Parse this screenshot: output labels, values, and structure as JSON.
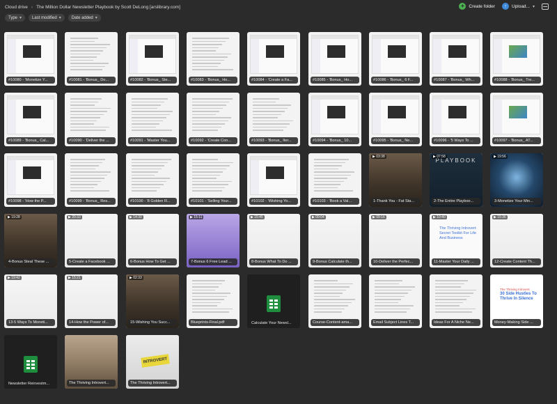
{
  "breadcrumb": {
    "root": "Cloud drive",
    "current": "The Million Dollar Newsletter Playbook by Scott DeLong [arslibrary.com]"
  },
  "toolbar": {
    "create_folder": "Create folder",
    "upload": "Upload..."
  },
  "filters": {
    "type": "Type",
    "last_modified": "Last modified",
    "date_added": "Date added"
  },
  "colors": {
    "background": "#2b2b2b",
    "create_folder_icon": "#4caf50",
    "upload_icon": "#3f8ad8",
    "sheet_icon": "#1e8e3e"
  },
  "files": [
    {
      "name": "#10080 - 'Monetize Y...",
      "kind": "screenshot"
    },
    {
      "name": "#10081 - 'Bonus_ Do...",
      "kind": "doc"
    },
    {
      "name": "#10082 - 'Bonus_ Ste...",
      "kind": "screenshot"
    },
    {
      "name": "#10083 - 'Bonus_ Ho...",
      "kind": "doc"
    },
    {
      "name": "#10084 - 'Create a Fa...",
      "kind": "screenshot"
    },
    {
      "name": "#10085 - 'Bonus_ Ho...",
      "kind": "screenshot"
    },
    {
      "name": "#10086 - 'Bonus_ 6 F...",
      "kind": "screenshot"
    },
    {
      "name": "#10087 - 'Bonus_ Wh...",
      "kind": "screenshot"
    },
    {
      "name": "#10088 - 'Bonus_ Tre...",
      "kind": "screenshot-color"
    },
    {
      "name": "#10089 - 'Bonus_ Cal...",
      "kind": "screenshot"
    },
    {
      "name": "#10090 - 'Deliver the ...",
      "kind": "doc"
    },
    {
      "name": "#10091 - 'Master You...",
      "kind": "doc"
    },
    {
      "name": "#10092 - 'Create Con...",
      "kind": "doc"
    },
    {
      "name": "#10093 - 'Bonus_ Iter...",
      "kind": "doc"
    },
    {
      "name": "#10094 - 'Bonus_ 10...",
      "kind": "screenshot"
    },
    {
      "name": "#10095 - 'Bonus_ Ne...",
      "kind": "screenshot"
    },
    {
      "name": "#10096 - '5 Ways To ...",
      "kind": "screenshot"
    },
    {
      "name": "#10097 - 'Bonus_ AT...",
      "kind": "screenshot-color"
    },
    {
      "name": "#10098 - 'How the P...",
      "kind": "screenshot"
    },
    {
      "name": "#10099 - 'Bonus_ Res...",
      "kind": "doc"
    },
    {
      "name": "#10100 - '8 Golden R...",
      "kind": "doc"
    },
    {
      "name": "#10101 - 'Selling Your...",
      "kind": "doc"
    },
    {
      "name": "#10102 - 'Wishing Yo...",
      "kind": "screenshot"
    },
    {
      "name": "#10103 - 'Book a Val...",
      "kind": "doc"
    },
    {
      "name": "1-Thank You - Fat Sta...",
      "kind": "video",
      "duration": "03:38"
    },
    {
      "name": "2-The Entire Playboo...",
      "kind": "video-playbook",
      "duration": "07:58"
    },
    {
      "name": "3-Monetize Your Min...",
      "kind": "video-blue",
      "duration": "19:56"
    },
    {
      "name": "4-Bonus Steal These ...",
      "kind": "video",
      "duration": "19:28"
    },
    {
      "name": "5-Create a Facebook ...",
      "kind": "video-light",
      "duration": "20:33"
    },
    {
      "name": "6-Bonus How To Get ...",
      "kind": "video-light",
      "duration": "14:30"
    },
    {
      "name": "7-Bonus 6 Free Lead ...",
      "kind": "video-purple",
      "duration": "15:11"
    },
    {
      "name": "8-Bonus What To Do ...",
      "kind": "video-light",
      "duration": "15:45"
    },
    {
      "name": "9-Bonus Calculate th...",
      "kind": "video-light",
      "duration": "09:04"
    },
    {
      "name": "10-Deliver the Perfec...",
      "kind": "video-light",
      "duration": "09:16"
    },
    {
      "name": "11-Master Your Daily ...",
      "kind": "video-white",
      "duration": "10:40",
      "heading": "The Thriving Introvert: Secret Toolkit For Life And Business"
    },
    {
      "name": "12-Create Content Th...",
      "kind": "video-light",
      "duration": "15:36"
    },
    {
      "name": "13-5 Ways To Moneti...",
      "kind": "video-light",
      "duration": "19:42"
    },
    {
      "name": "14-How the Power of...",
      "kind": "video-light",
      "duration": "15:21"
    },
    {
      "name": "15-Wishing You Succ...",
      "kind": "video",
      "duration": "02:33"
    },
    {
      "name": "Blueprints-Final.pdf",
      "kind": "doc"
    },
    {
      "name": "Calculate Your Newsl...",
      "kind": "sheet"
    },
    {
      "name": "Course-Content-ama...",
      "kind": "doc"
    },
    {
      "name": "Email Subject Lines T...",
      "kind": "doc"
    },
    {
      "name": "Ideas For A Niche Ne...",
      "kind": "doc"
    },
    {
      "name": "Money-Making Side ...",
      "kind": "cover",
      "heading_small": "The Thriving Introvert",
      "heading": "30 Side Hustles To Thrive In Silence"
    },
    {
      "name": "Newsletter Reinvestm...",
      "kind": "sheet"
    },
    {
      "name": "The Thriving Introvert...",
      "kind": "photo-laptop"
    },
    {
      "name": "The Thriving Introvert...",
      "kind": "photo-introvert",
      "tag": "INTROVERT"
    }
  ]
}
